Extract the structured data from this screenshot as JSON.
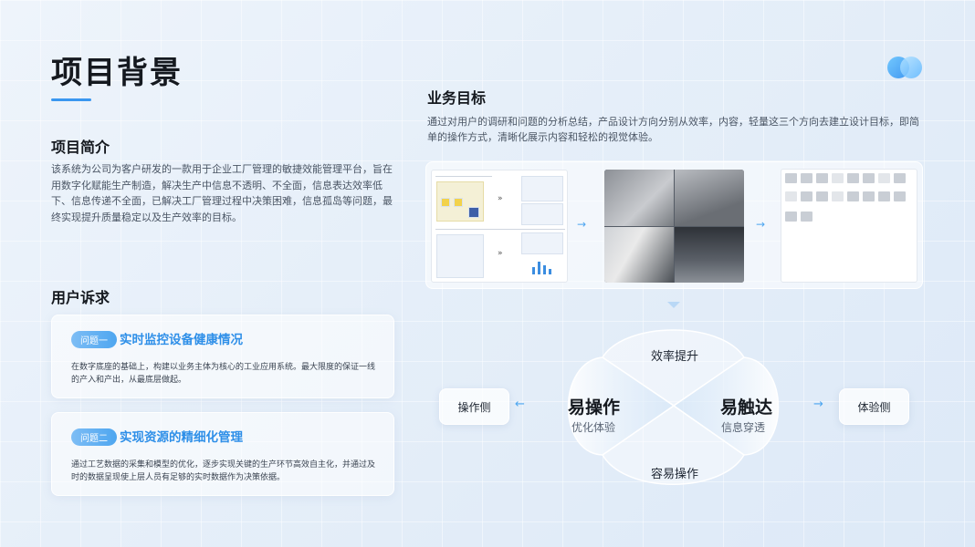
{
  "page": {
    "title": "项目背景"
  },
  "intro": {
    "heading": "项目简介",
    "text": "该系统为公司为客户研发的一款用于企业工厂管理的敏捷效能管理平台，旨在用数字化赋能生产制造，解决生产中信息不透明、不全面，信息表达效率低下、信息传递不全面，已解决工厂管理过程中决策困难，信息孤岛等问题，最终实现提升质量稳定以及生产效率的目标。"
  },
  "needs": {
    "heading": "用户诉求",
    "cards": [
      {
        "tag": "问题一",
        "title": "实时监控设备健康情况",
        "body": "在数字底座的基础上，构建以业务主体为核心的工业应用系统。最大限度的保证一线的产入和产出，从最底层做起。"
      },
      {
        "tag": "问题二",
        "title": "实现资源的精细化管理",
        "body": "通过工艺数据的采集和模型的优化，逐步实现关键的生产环节高效自主化，并通过及时的数据呈现使上层人员有足够的实时数据作为决策依据。"
      }
    ]
  },
  "business": {
    "heading": "业务目标",
    "text": "通过对用户的调研和问题的分析总结，产品设计方向分别从效率，内容，轻量这三个方向去建立设计目标，即简单的操作方式，清晰化展示内容和轻松的视觉体验。"
  },
  "diagram": {
    "top": "效率提升",
    "bottom": "容易操作",
    "left_title": "易操作",
    "left_sub": "优化体验",
    "right_title": "易触达",
    "right_sub": "信息穿透",
    "left_button": "操作侧",
    "right_button": "体验侧",
    "accent": "#4ea6f0"
  },
  "colors": {
    "accent": "#3a97f0",
    "card_title": "#2e8fe8"
  }
}
